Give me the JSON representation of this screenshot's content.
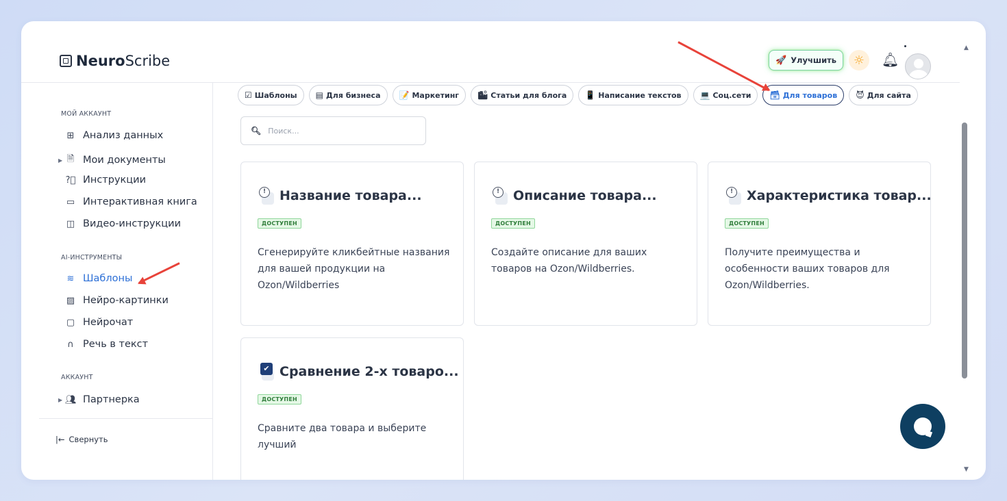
{
  "app": {
    "logo_bold": "Neuro",
    "logo_rest": "Scribe"
  },
  "header": {
    "upgrade_label": "Улучшить"
  },
  "sidebar": {
    "section_account": "МОЙ АККАУНТ",
    "account_items": [
      {
        "label": "Анализ данных",
        "icon": "grid-icon"
      },
      {
        "label": "Мои документы",
        "icon": "document-icon"
      },
      {
        "label": "Инструкции",
        "icon": "help-circle-icon"
      },
      {
        "label": "Интерактивная книга",
        "icon": "book-icon"
      },
      {
        "label": "Видео-инструкции",
        "icon": "video-icon"
      }
    ],
    "section_ai": "AI-ИНСТРУМЕНТЫ",
    "ai_items": [
      {
        "label": "Шаблоны",
        "icon": "layers-icon",
        "active": true
      },
      {
        "label": "Нейро-картинки",
        "icon": "image-icon"
      },
      {
        "label": "Нейрочат",
        "icon": "chat-icon"
      },
      {
        "label": "Речь в текст",
        "icon": "headphones-icon"
      }
    ],
    "section_acc": "АККАУНТ",
    "acc_items": [
      {
        "label": "Партнерка",
        "icon": "users-icon"
      }
    ],
    "collapse_label": "Свернуть"
  },
  "tabs": [
    {
      "label": "Шаблоны",
      "icon": "☑"
    },
    {
      "label": "Для бизнеса",
      "icon": "▤"
    },
    {
      "label": "Маркетинг",
      "icon": "📝"
    },
    {
      "label": "Статьи для блога",
      "icon": "🏙"
    },
    {
      "label": "Написание текстов",
      "icon": "📱"
    },
    {
      "label": "Соц.сети",
      "icon": "💻"
    },
    {
      "label": "Для товаров",
      "icon": "🗃",
      "active": true
    },
    {
      "label": "Для сайта",
      "icon": "😈"
    }
  ],
  "search": {
    "placeholder": "Поиск..."
  },
  "cards": [
    {
      "title": "Название товара...",
      "badge": "ДОСТУПЕН",
      "desc": "Сгенерируйте кликбейтные названия для вашей продукции на Ozon/Wildberries",
      "icon": "clock-icon"
    },
    {
      "title": "Описание товара...",
      "badge": "ДОСТУПЕН",
      "desc": "Создайте описание для ваших товаров на Ozon/Wildberries.",
      "icon": "clock-icon"
    },
    {
      "title": "Характеристика товар...",
      "badge": "ДОСТУПЕН",
      "desc": "Получите преимущества и особенности ваших товаров для Ozon/Wildberries.",
      "icon": "clock-icon"
    },
    {
      "title": "Сравнение 2-х товаро...",
      "badge": "ДОСТУПЕН",
      "desc": "Сравните два товара и выберите лучший",
      "icon": "checkbox-icon"
    }
  ],
  "colors": {
    "accent": "#2c6fd6",
    "chat": "#0e3f61",
    "badge_bg": "#e5f8e6",
    "annotation_arrow": "#e8433a"
  }
}
